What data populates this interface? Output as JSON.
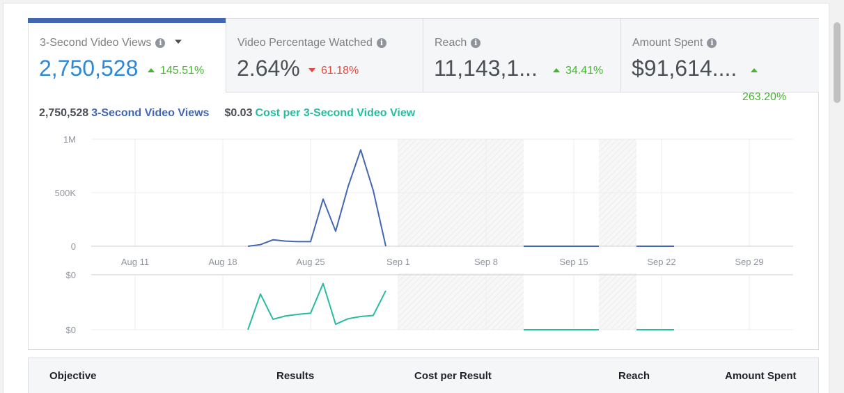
{
  "tabs": [
    {
      "label": "3-Second Video Views",
      "value": "2,750,528",
      "change": "145.51%",
      "direction": "up",
      "has_dropdown": true
    },
    {
      "label": "Video Percentage Watched",
      "value": "2.64%",
      "change": "61.18%",
      "direction": "down"
    },
    {
      "label": "Reach",
      "value": "11,143,1...",
      "change": "34.41%",
      "direction": "up"
    },
    {
      "label": "Amount Spent",
      "value": "$91,614....",
      "change": "263.20%",
      "direction": "up"
    }
  ],
  "summary": {
    "primary_value": "2,750,528",
    "primary_label": "3-Second Video Views",
    "secondary_value": "$0.03",
    "secondary_label": "Cost per 3-Second Video View"
  },
  "colors": {
    "accent": "#4267b2",
    "primary_series": "#4267b2",
    "secondary_series": "#27bba0",
    "positive": "#42b72a",
    "negative": "#e9453a",
    "active_value": "#2d88d8"
  },
  "chart_data": [
    {
      "type": "line",
      "series": [
        {
          "name": "3-Second Video Views"
        }
      ],
      "x_ticks": [
        "Aug 11",
        "Aug 18",
        "Aug 25",
        "Sep 1",
        "Sep 8",
        "Sep 15",
        "Sep 22",
        "Sep 29"
      ],
      "y_ticks": [
        "0",
        "500K",
        "1M"
      ],
      "ylim": [
        0,
        1000000
      ],
      "points": [
        [
          "Aug 20",
          0
        ],
        [
          "Aug 21",
          15000
        ],
        [
          "Aug 22",
          60000
        ],
        [
          "Aug 23",
          48000
        ],
        [
          "Aug 24",
          43000
        ],
        [
          "Aug 25",
          43000
        ],
        [
          "Aug 26",
          440000
        ],
        [
          "Aug 27",
          140000
        ],
        [
          "Aug 28",
          560000
        ],
        [
          "Aug 29",
          900000
        ],
        [
          "Aug 30",
          520000
        ],
        [
          "Aug 31",
          0
        ]
      ],
      "segments_after": [
        {
          "start": "Sep 11",
          "end": "Sep 17",
          "value": 0
        },
        {
          "start": "Sep 20",
          "end": "Sep 23",
          "value": 0
        }
      ],
      "shaded_ranges": [
        [
          "Sep 1",
          "Sep 11"
        ],
        [
          "Sep 17",
          "Sep 20"
        ]
      ]
    },
    {
      "type": "line",
      "series": [
        {
          "name": "Cost per 3-Second Video View"
        }
      ],
      "y_ticks": [
        "$0",
        "$0"
      ],
      "points": [
        [
          "Aug 20",
          0.0
        ],
        [
          "Aug 21",
          0.65
        ],
        [
          "Aug 22",
          0.19
        ],
        [
          "Aug 23",
          0.25
        ],
        [
          "Aug 24",
          0.28
        ],
        [
          "Aug 25",
          0.3
        ],
        [
          "Aug 26",
          0.84
        ],
        [
          "Aug 27",
          0.1
        ],
        [
          "Aug 28",
          0.2
        ],
        [
          "Aug 29",
          0.24
        ],
        [
          "Aug 30",
          0.26
        ],
        [
          "Aug 31",
          0.71
        ]
      ],
      "segments_after": [
        {
          "start": "Sep 11",
          "end": "Sep 17",
          "value": 0.0
        },
        {
          "start": "Sep 20",
          "end": "Sep 23",
          "value": 0.0
        }
      ]
    }
  ],
  "table_header": {
    "objective": "Objective",
    "results": "Results",
    "cost_per_result": "Cost per Result",
    "reach": "Reach",
    "amount_spent": "Amount Spent"
  }
}
